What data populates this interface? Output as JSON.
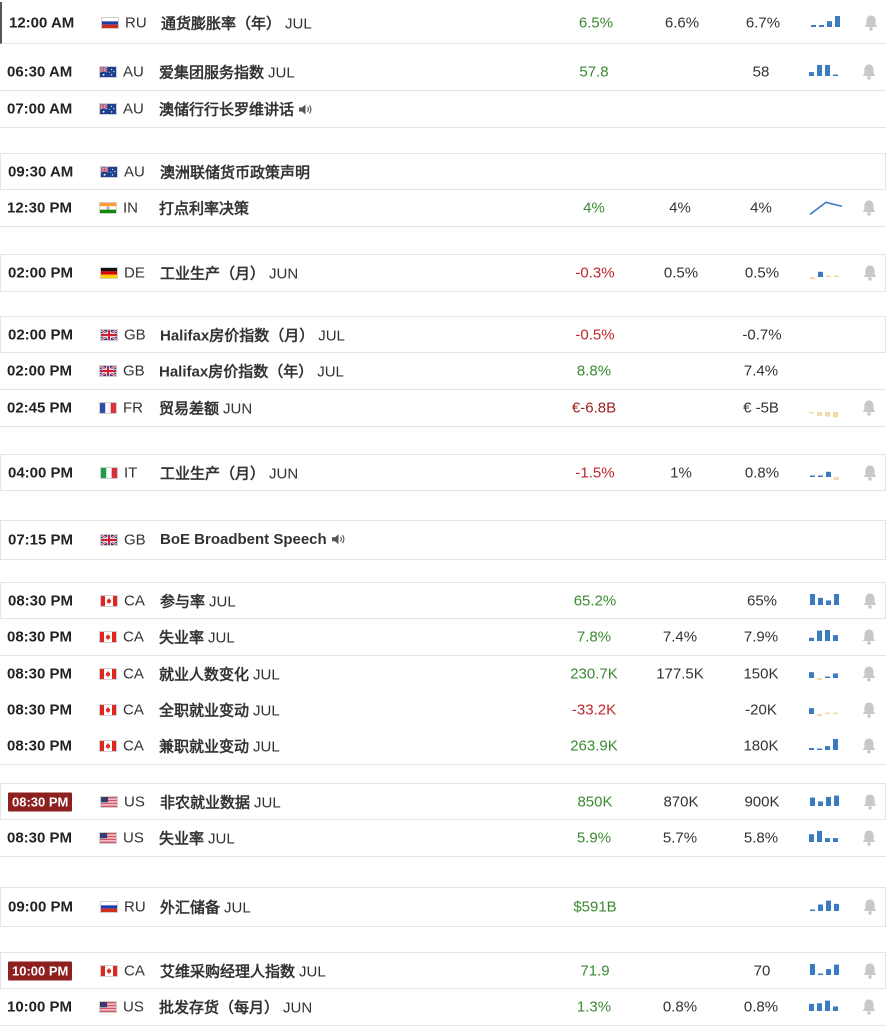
{
  "colors": {
    "positive": "#3a8a32",
    "negative": "#c0262d",
    "neutral": "#333333",
    "spark_blue": "#3b7bbf",
    "spark_tan": "#f2d9a8",
    "badge_red": "#8e1f1f",
    "bell_gray": "#c8c8c8"
  },
  "rows": [
    {
      "time": "12:00 AM",
      "time_style": "plain",
      "flag": "ru-flag-icon",
      "country": "RU",
      "event": "通货膨胀率（年）",
      "period": "JUL",
      "event_bold": true,
      "actual": "6.5%",
      "actual_tone": "positive",
      "forecast": "6.6%",
      "previous": "6.7%",
      "spark": {
        "kind": "bars",
        "bars": [
          0.15,
          0.15,
          0.45,
          0.85
        ],
        "colors": [
          "blue",
          "blue",
          "blue",
          "blue"
        ]
      },
      "bell": true
    },
    {
      "time": "06:30 AM",
      "time_style": "plain",
      "flag": "au-flag-icon",
      "country": "AU",
      "event": "爱集团服务指数",
      "period": "JUL",
      "event_bold": true,
      "actual": "57.8",
      "actual_tone": "positive",
      "forecast": "",
      "previous": "58",
      "spark": {
        "kind": "bars",
        "bars": [
          0.3,
          0.85,
          0.85,
          0.1
        ],
        "colors": [
          "blue",
          "blue",
          "blue",
          "blue"
        ]
      },
      "bell": true
    },
    {
      "time": "07:00 AM",
      "time_style": "plain",
      "flag": "au-flag-icon",
      "country": "AU",
      "event": "澳储行行长罗维讲话",
      "period": "",
      "event_bold": true,
      "speaker": true,
      "actual": "",
      "actual_tone": "neutral",
      "forecast": "",
      "previous": "",
      "spark": null,
      "bell": false
    },
    {
      "time": "09:30 AM",
      "time_style": "plain",
      "flag": "au-flag-icon",
      "country": "AU",
      "event": "澳洲联储货币政策声明",
      "period": "",
      "event_bold": true,
      "actual": "",
      "actual_tone": "neutral",
      "forecast": "",
      "previous": "",
      "spark": null,
      "bell": false
    },
    {
      "time": "12:30 PM",
      "time_style": "plain",
      "flag": "in-flag-icon",
      "country": "IN",
      "event": "打点利率决策",
      "period": "",
      "event_bold": true,
      "actual": "4%",
      "actual_tone": "positive",
      "forecast": "4%",
      "previous": "4%",
      "spark": {
        "kind": "line",
        "points": [
          0.1,
          0.85,
          0.6
        ]
      },
      "bell": true
    },
    {
      "time": "02:00 PM",
      "time_style": "plain",
      "flag": "de-flag-icon",
      "country": "DE",
      "event": "工业生产（月）",
      "period": "JUN",
      "event_bold": true,
      "actual": "-0.3%",
      "actual_tone": "negative",
      "forecast": "0.5%",
      "previous": "0.5%",
      "spark": {
        "kind": "bars",
        "bars": [
          -0.35,
          0.4,
          0.05,
          0.05
        ],
        "colors": [
          "tan",
          "blue",
          "tan",
          "tan"
        ]
      },
      "bell": true
    },
    {
      "time": "02:00 PM",
      "time_style": "plain",
      "flag": "gb-flag-icon",
      "country": "GB",
      "event": "Halifax房价指数（月）",
      "period": "JUL",
      "event_bold": true,
      "actual": "-0.5%",
      "actual_tone": "negative",
      "forecast": "",
      "previous": "-0.7%",
      "spark": null,
      "bell": false
    },
    {
      "time": "02:00 PM",
      "time_style": "plain",
      "flag": "gb-flag-icon",
      "country": "GB",
      "event": "Halifax房价指数（年）",
      "period": "JUL",
      "event_bold": true,
      "actual": "8.8%",
      "actual_tone": "positive",
      "forecast": "",
      "previous": "7.4%",
      "spark": null,
      "bell": false
    },
    {
      "time": "02:45 PM",
      "time_style": "plain",
      "flag": "fr-flag-icon",
      "country": "FR",
      "event": "贸易差额",
      "period": "JUN",
      "event_bold": true,
      "actual": "€-6.8B",
      "actual_tone": "dark-red",
      "forecast": "",
      "previous": "€ -5B",
      "spark": {
        "kind": "bars",
        "bars": [
          -0.2,
          -0.6,
          -0.7,
          -0.85
        ],
        "colors": [
          "tan",
          "tan",
          "tan",
          "tan"
        ]
      },
      "bell": true
    },
    {
      "time": "04:00 PM",
      "time_style": "plain",
      "flag": "it-flag-icon",
      "country": "IT",
      "event": "工业生产（月）",
      "period": "JUN",
      "event_bold": true,
      "actual": "-1.5%",
      "actual_tone": "negative",
      "forecast": "1%",
      "previous": "0.8%",
      "spark": {
        "kind": "bars",
        "bars": [
          0.08,
          0.1,
          0.4,
          -0.45
        ],
        "colors": [
          "blue",
          "blue",
          "blue",
          "tan"
        ]
      },
      "bell": true
    },
    {
      "time": "07:15 PM",
      "time_style": "plain",
      "flag": "gb-flag-icon",
      "country": "GB",
      "event": "BoE Broadbent Speech",
      "period": "",
      "event_bold": true,
      "speaker": true,
      "actual": "",
      "actual_tone": "neutral",
      "forecast": "",
      "previous": "",
      "spark": null,
      "bell": false
    },
    {
      "time": "08:30 PM",
      "time_style": "plain",
      "flag": "ca-flag-icon",
      "country": "CA",
      "event": "参与率",
      "period": "JUL",
      "event_bold": true,
      "actual": "65.2%",
      "actual_tone": "positive",
      "forecast": "",
      "previous": "65%",
      "spark": {
        "kind": "bars",
        "bars": [
          0.85,
          0.55,
          0.35,
          0.85
        ],
        "colors": [
          "blue",
          "blue",
          "blue",
          "blue"
        ]
      },
      "bell": true
    },
    {
      "time": "08:30 PM",
      "time_style": "plain",
      "flag": "ca-flag-icon",
      "country": "CA",
      "event": "失业率",
      "period": "JUL",
      "event_bold": true,
      "actual": "7.8%",
      "actual_tone": "positive",
      "forecast": "7.4%",
      "previous": "7.9%",
      "spark": {
        "kind": "bars",
        "bars": [
          0.25,
          0.8,
          0.85,
          0.45
        ],
        "colors": [
          "blue",
          "blue",
          "blue",
          "blue"
        ]
      },
      "bell": true
    },
    {
      "time": "08:30 PM",
      "time_style": "plain",
      "flag": "ca-flag-icon",
      "country": "CA",
      "event": "就业人数变化",
      "period": "JUL",
      "event_bold": true,
      "actual": "230.7K",
      "actual_tone": "positive",
      "forecast": "177.5K",
      "previous": "150K",
      "spark": {
        "kind": "bars",
        "bars": [
          0.45,
          -0.3,
          0.1,
          0.35
        ],
        "colors": [
          "blue",
          "tan",
          "blue",
          "blue"
        ]
      },
      "bell": true
    },
    {
      "time": "08:30 PM",
      "time_style": "plain",
      "flag": "ca-flag-icon",
      "country": "CA",
      "event": "全职就业变动",
      "period": "JUL",
      "event_bold": true,
      "actual": "-33.2K",
      "actual_tone": "negative",
      "forecast": "",
      "previous": "-20K",
      "spark": {
        "kind": "bars",
        "bars": [
          0.45,
          -0.3,
          0.05,
          0.05
        ],
        "colors": [
          "blue",
          "tan",
          "tan",
          "tan"
        ]
      },
      "bell": true
    },
    {
      "time": "08:30 PM",
      "time_style": "plain",
      "flag": "ca-flag-icon",
      "country": "CA",
      "event": "兼职就业变动",
      "period": "JUL",
      "event_bold": true,
      "actual": "263.9K",
      "actual_tone": "positive",
      "forecast": "",
      "previous": "180K",
      "spark": {
        "kind": "bars",
        "bars": [
          0.15,
          0.08,
          0.3,
          0.85
        ],
        "colors": [
          "blue",
          "blue",
          "blue",
          "blue"
        ]
      },
      "bell": true
    },
    {
      "time": "08:30 PM",
      "time_style": "badge",
      "flag": "us-flag-icon",
      "country": "US",
      "event": "非农就业数据",
      "period": "JUL",
      "event_bold": true,
      "actual": "850K",
      "actual_tone": "positive",
      "forecast": "870K",
      "previous": "900K",
      "spark": {
        "kind": "bars",
        "bars": [
          0.65,
          0.35,
          0.7,
          0.8
        ],
        "colors": [
          "blue",
          "blue",
          "blue",
          "blue"
        ]
      },
      "bell": true
    },
    {
      "time": "08:30 PM",
      "time_style": "plain",
      "flag": "us-flag-icon",
      "country": "US",
      "event": "失业率",
      "period": "JUL",
      "event_bold": true,
      "actual": "5.9%",
      "actual_tone": "positive",
      "forecast": "5.7%",
      "previous": "5.8%",
      "spark": {
        "kind": "bars",
        "bars": [
          0.6,
          0.85,
          0.3,
          0.3
        ],
        "colors": [
          "blue",
          "blue",
          "blue",
          "blue"
        ]
      },
      "bell": true
    },
    {
      "time": "09:00 PM",
      "time_style": "plain",
      "flag": "ru-flag-icon",
      "country": "RU",
      "event": "外汇储备",
      "period": "JUL",
      "event_bold": true,
      "actual": "$591B",
      "actual_tone": "positive",
      "forecast": "",
      "previous": "",
      "spark": {
        "kind": "bars",
        "bars": [
          0.1,
          0.5,
          0.8,
          0.55
        ],
        "colors": [
          "blue",
          "blue",
          "blue",
          "blue"
        ]
      },
      "bell": true
    },
    {
      "time": "10:00 PM",
      "time_style": "badge",
      "flag": "ca-flag-icon",
      "country": "CA",
      "event": "艾维采购经理人指数",
      "period": "JUL",
      "event_bold": true,
      "actual": "71.9",
      "actual_tone": "positive",
      "forecast": "",
      "previous": "70",
      "spark": {
        "kind": "bars",
        "bars": [
          0.85,
          0.1,
          0.45,
          0.8
        ],
        "colors": [
          "blue",
          "blue",
          "blue",
          "blue"
        ]
      },
      "bell": true
    },
    {
      "time": "10:00 PM",
      "time_style": "plain",
      "flag": "us-flag-icon",
      "country": "US",
      "event": "批发存货（每月）",
      "period": "JUN",
      "event_bold": true,
      "actual": "1.3%",
      "actual_tone": "positive",
      "forecast": "0.8%",
      "previous": "0.8%",
      "spark": {
        "kind": "bars",
        "bars": [
          0.55,
          0.6,
          0.8,
          0.35
        ],
        "colors": [
          "blue",
          "blue",
          "blue",
          "blue"
        ]
      },
      "bell": true
    }
  ]
}
